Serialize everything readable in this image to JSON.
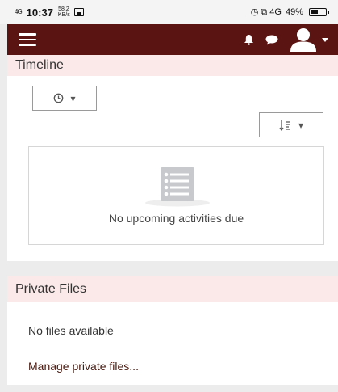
{
  "status_bar": {
    "signal": "4G",
    "time": "10:37",
    "speed": "58.2 KB/s",
    "right_icons": "◷ ⧉ 4G",
    "battery_percent": "49%",
    "battery_level": 0.49
  },
  "app_bar": {
    "color": "#5a1512",
    "icons": [
      "hamburger-icon",
      "bell-icon",
      "chat-icon",
      "user-avatar-icon",
      "caret-down-icon"
    ]
  },
  "timeline": {
    "title": "Timeline",
    "filter_caret": "▾",
    "sort_caret": "▾",
    "empty_message": "No upcoming activities due"
  },
  "private_files": {
    "title": "Private Files",
    "empty_message": "No files available",
    "manage_link": "Manage private files..."
  },
  "colors": {
    "accent": "#5a1512",
    "header_bg": "#fbe9e9",
    "page_bg": "#ececec"
  }
}
